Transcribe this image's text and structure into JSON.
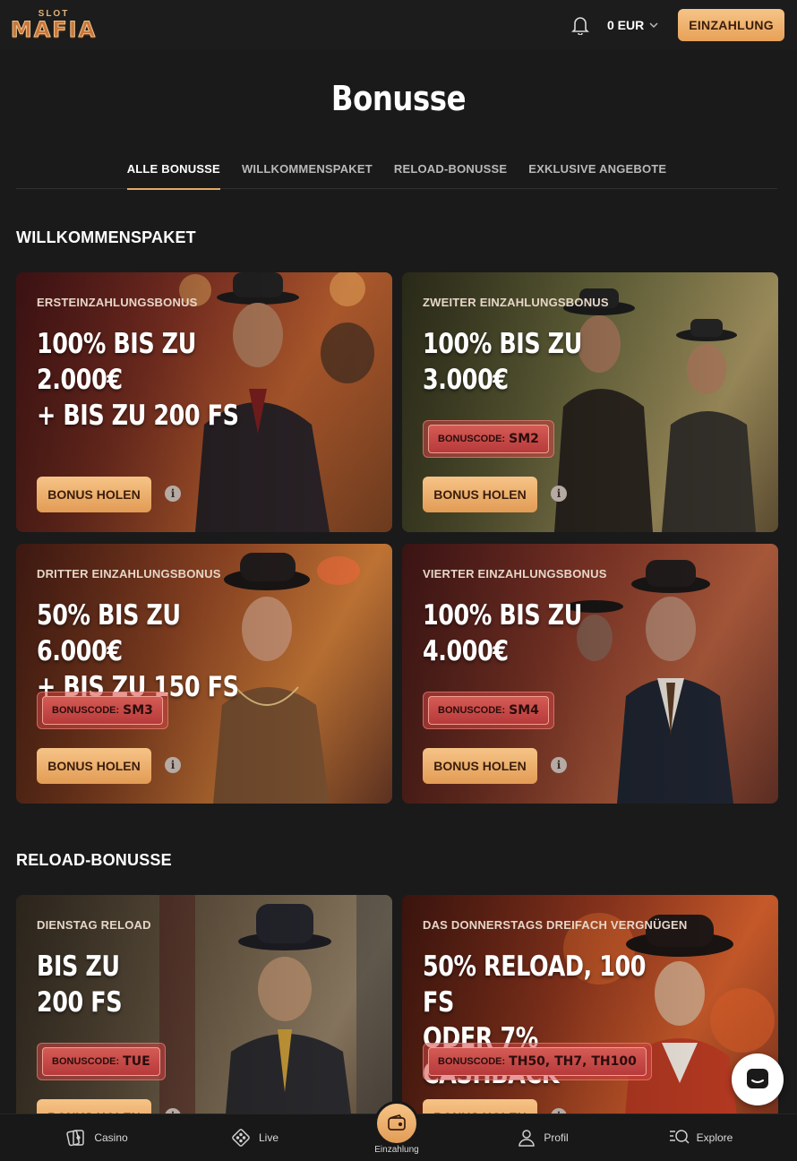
{
  "header": {
    "logo_top": "SLOT",
    "logo_main": "MAFIA",
    "balance": "0 EUR",
    "deposit_label": "EINZAHLUNG"
  },
  "page": {
    "title": "Bonusse",
    "tabs": [
      {
        "label": "ALLE BONUSSE",
        "active": true
      },
      {
        "label": "WILLKOMMENSPAKET",
        "active": false
      },
      {
        "label": "RELOAD-BONUSSE",
        "active": false
      },
      {
        "label": "EXKLUSIVE ANGEBOTE",
        "active": false
      }
    ]
  },
  "sections": {
    "welcome": {
      "title": "WILLKOMMENSPAKET",
      "cards": [
        {
          "label": "ERSTEINZAHLUNGSBONUS",
          "headline": "100% BIS ZU 2.000€\n+ BIS ZU 200 FS",
          "code_prefix": "",
          "code": "",
          "cta": "BONUS HOLEN",
          "info": "i"
        },
        {
          "label": "ZWEITER EINZAHLUNGSBONUS",
          "headline": "100% BIS ZU\n3.000€",
          "code_prefix": "BONUSCODE:",
          "code": "SM2",
          "cta": "BONUS HOLEN",
          "info": "i"
        },
        {
          "label": "DRITTER EINZAHLUNGSBONUS",
          "headline": "50% BIS ZU 6.000€\n+ BIS ZU 150 FS",
          "code_prefix": "BONUSCODE:",
          "code": "SM3",
          "cta": "BONUS HOLEN",
          "info": "i"
        },
        {
          "label": "VIERTER EINZAHLUNGSBONUS",
          "headline": "100% BIS ZU\n4.000€",
          "code_prefix": "BONUSCODE:",
          "code": "SM4",
          "cta": "BONUS HOLEN",
          "info": "i"
        }
      ]
    },
    "reload": {
      "title": "RELOAD-BONUSSE",
      "cards": [
        {
          "label": "DIENSTAG RELOAD",
          "headline": "BIS ZU\n200 FS",
          "code_prefix": "BONUSCODE:",
          "code": "TUE",
          "cta": "BONUS HOLEN",
          "info": "i"
        },
        {
          "label": "DAS DONNERSTAGS DREIFACH VERGNÜGEN",
          "headline": "50% RELOAD, 100 FS\nODER 7% CASHBACK",
          "code_prefix": "BONUSCODE:",
          "code": "TH50, TH7, TH100",
          "cta": "BONUS HOLEN",
          "info": "i"
        }
      ]
    }
  },
  "bottom_nav": {
    "casino": "Casino",
    "live": "Live",
    "deposit": "Einzahlung",
    "profile": "Profil",
    "explore": "Explore"
  },
  "colors": {
    "accent": "#e7a865",
    "background": "#1a1a1a",
    "code_badge": "#c04848"
  }
}
